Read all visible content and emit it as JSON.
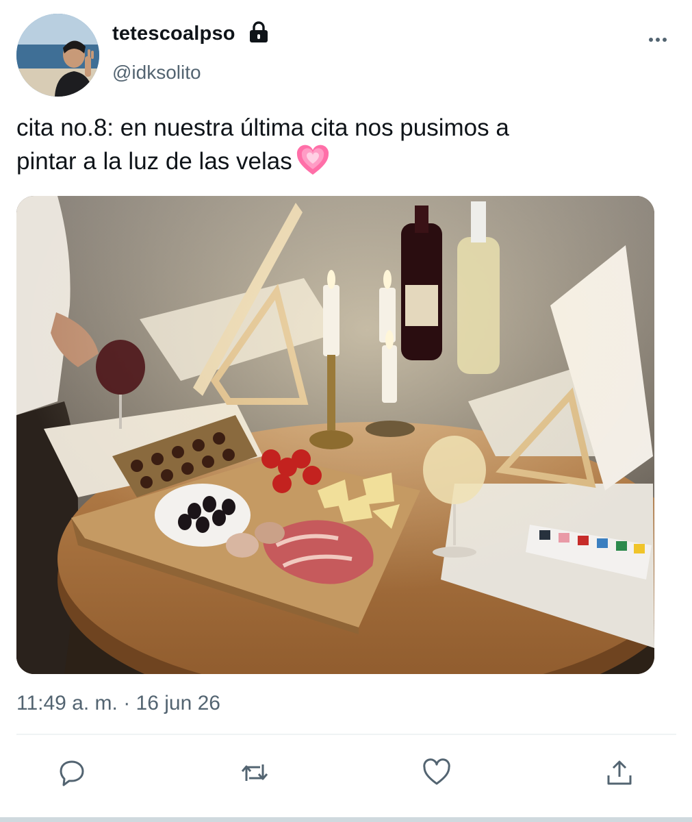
{
  "author": {
    "display_name": "tetescoalpso",
    "handle": "@idksolito",
    "protected_icon": "lock-icon"
  },
  "tweet": {
    "text_line1": "cita no.8: en nuestra última cita nos pusimos a",
    "text_line2": "pintar a la luz de las velas",
    "emoji": "pink-heart-icon",
    "timestamp": "11:49 a. m. · 16 jun 26"
  },
  "actions": [
    {
      "name": "reply",
      "icon": "speech-bubble-icon"
    },
    {
      "name": "retweet",
      "icon": "retweet-arrows-icon"
    },
    {
      "name": "like",
      "icon": "heart-outline-icon"
    },
    {
      "name": "share",
      "icon": "share-upload-icon"
    }
  ],
  "colors": {
    "primary_text": "#0f1419",
    "secondary_text": "#536471",
    "divider": "#eff3f4",
    "heart_emoji": "#ff6fa8"
  }
}
